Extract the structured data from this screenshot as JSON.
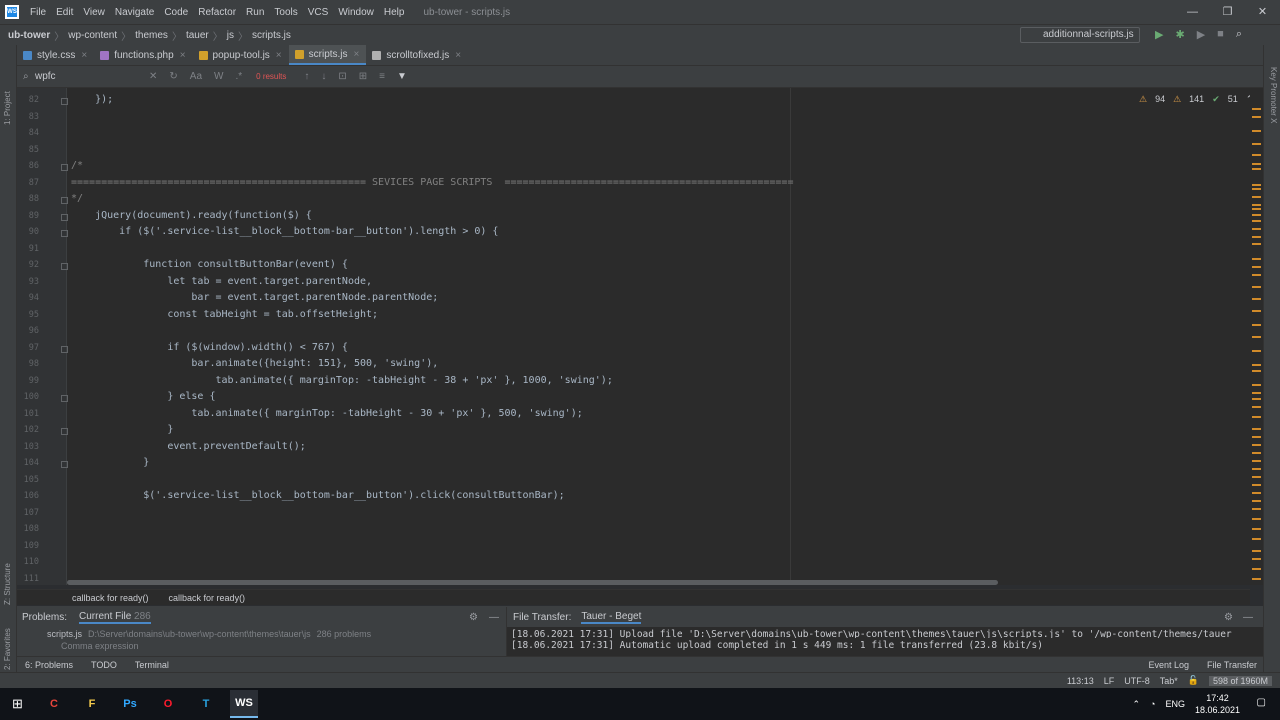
{
  "window": {
    "title": "ub-tower - scripts.js",
    "menu": [
      "File",
      "Edit",
      "View",
      "Navigate",
      "Code",
      "Refactor",
      "Run",
      "Tools",
      "VCS",
      "Window",
      "Help"
    ],
    "logo": "WS"
  },
  "nav": {
    "crumbs": [
      "ub-tower",
      "wp-content",
      "themes",
      "tauer",
      "js",
      "scripts.js"
    ],
    "run_config": "additionnal-scripts.js"
  },
  "tabs": [
    {
      "label": "style.css",
      "color": "#4a88c7"
    },
    {
      "label": "functions.php",
      "color": "#a074c4"
    },
    {
      "label": "popup-tool.js",
      "color": "#d1a02b"
    },
    {
      "label": "scripts.js",
      "color": "#d1a02b",
      "active": true
    },
    {
      "label": "scrolltofixed.js",
      "color": "#b0b0b0"
    }
  ],
  "find": {
    "value": "wpfc",
    "results": "0 results",
    "toolbar": [
      "Aa",
      "W",
      ".*"
    ]
  },
  "inspections": {
    "warnings": "94",
    "weak": "141",
    "ok": "51"
  },
  "code": [
    {
      "n": "82",
      "t": "    });"
    },
    {
      "n": "83",
      "t": ""
    },
    {
      "n": "84",
      "t": ""
    },
    {
      "n": "85",
      "t": ""
    },
    {
      "n": "86",
      "t": "/*"
    },
    {
      "n": "87",
      "t": "================================================= SEVICES PAGE SCRIPTS  ================================================"
    },
    {
      "n": "88",
      "t": "*/"
    },
    {
      "n": "89",
      "t": "    jQuery(document).ready(function($) {"
    },
    {
      "n": "90",
      "t": "        if ($('.service-list__block__bottom-bar__button').length > 0) {"
    },
    {
      "n": "91",
      "t": ""
    },
    {
      "n": "92",
      "t": "            function consultButtonBar(event) {"
    },
    {
      "n": "93",
      "t": "                let tab = event.target.parentNode,"
    },
    {
      "n": "94",
      "t": "                    bar = event.target.parentNode.parentNode;"
    },
    {
      "n": "95",
      "t": "                const tabHeight = tab.offsetHeight;"
    },
    {
      "n": "96",
      "t": ""
    },
    {
      "n": "97",
      "t": "                if ($(window).width() < 767) {"
    },
    {
      "n": "98",
      "t": "                    bar.animate({height: 151}, 500, 'swing'),"
    },
    {
      "n": "99",
      "t": "                        tab.animate({ marginTop: -tabHeight - 38 + 'px' }, 1000, 'swing');"
    },
    {
      "n": "100",
      "t": "                } else {"
    },
    {
      "n": "101",
      "t": "                    tab.animate({ marginTop: -tabHeight - 30 + 'px' }, 500, 'swing');"
    },
    {
      "n": "102",
      "t": "                }"
    },
    {
      "n": "103",
      "t": "                event.preventDefault();"
    },
    {
      "n": "104",
      "t": "            }"
    },
    {
      "n": "105",
      "t": ""
    },
    {
      "n": "106",
      "t": "            $('.service-list__block__bottom-bar__button').click(consultButtonBar);"
    },
    {
      "n": "107",
      "t": ""
    },
    {
      "n": "108",
      "t": ""
    },
    {
      "n": "109",
      "t": ""
    },
    {
      "n": "110",
      "t": ""
    },
    {
      "n": "111",
      "t": ""
    }
  ],
  "breadcrumb": [
    "callback for ready()",
    "callback for ready()"
  ],
  "problems": {
    "title": "Problems:",
    "tab": "Current File",
    "count": "286",
    "file": "scripts.js",
    "path": "D:\\Server\\domains\\ub-tower\\wp-content\\themes\\tauer\\js",
    "file_problems": "286 problems",
    "sub": "Comma expression"
  },
  "transfer": {
    "title": "File Transfer:",
    "tab": "Tauer - Beget",
    "line1": "[18.06.2021 17:31] Upload file 'D:\\Server\\domains\\ub-tower\\wp-content\\themes\\tauer\\js\\scripts.js' to '/wp-content/themes/tauer",
    "line2": "[18.06.2021 17:31] Automatic upload completed in 1 s 449 ms: 1 file transferred (23.8 kbit/s)"
  },
  "toolwindows": {
    "left": [
      "6: Problems",
      "TODO",
      "Terminal"
    ],
    "right": [
      "Event Log",
      "File Transfer"
    ]
  },
  "side": {
    "left_top": "1: Project",
    "left_mid": "Z: Structure",
    "left_bot": "2: Favorites",
    "right_top": "Key Promoter X"
  },
  "status": {
    "pos": "113:13",
    "eol": "LF",
    "enc": "UTF-8",
    "indent": "Tab*",
    "mem": "598 of 1960M"
  },
  "taskbar": {
    "apps": [
      "C",
      "F",
      "Ps",
      "O",
      "T",
      "WS"
    ],
    "lang": "ENG",
    "time": "17:42",
    "date": "18.06.2021"
  }
}
